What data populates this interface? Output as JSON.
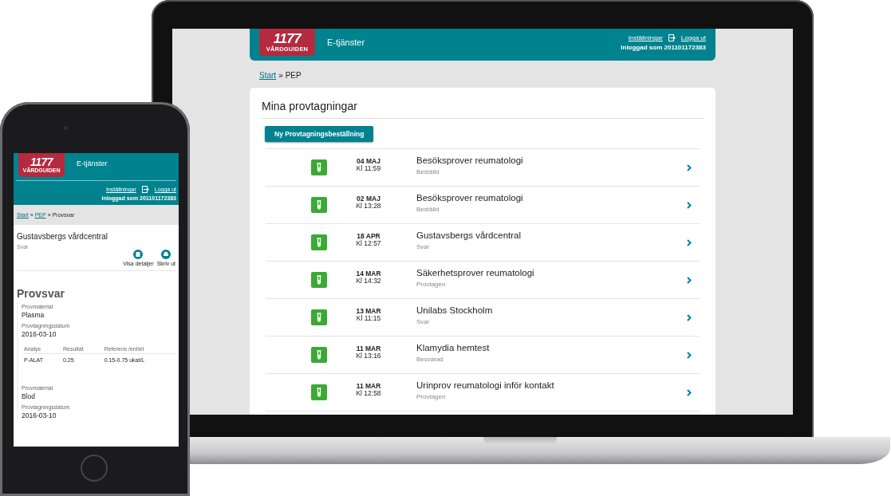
{
  "laptop": {
    "header": {
      "logo_number": "1177",
      "logo_name": "VÅRDGUIDEN",
      "service": "E-tjänster",
      "settings_link": "Inställningar",
      "logout_link": "Logga ut",
      "logged_in": "Inloggad som 201101172383"
    },
    "breadcrumb": [
      {
        "text": "Start",
        "link": true
      },
      {
        "text": "»",
        "link": false
      },
      {
        "text": "PEP",
        "link": false
      }
    ],
    "title": "Mina provtagningar",
    "new_button": "Ny Provtagningsbeställning",
    "orders": [
      {
        "date": "04 MAJ",
        "time": "Kl 11:59",
        "title": "Besöksprover reumatologi",
        "status": "Beställd"
      },
      {
        "date": "02 MAJ",
        "time": "Kl 13:28",
        "title": "Besöksprover reumatologi",
        "status": "Beställd"
      },
      {
        "date": "18 APR",
        "time": "Kl 12:57",
        "title": "Gustavsbergs vårdcentral",
        "status": "Svar"
      },
      {
        "date": "14 MAR",
        "time": "Kl 14:32",
        "title": "Säkerhetsprover reumatologi",
        "status": "Provtagen"
      },
      {
        "date": "13 MAR",
        "time": "Kl 11:15",
        "title": "Unilabs Stockholm",
        "status": "Svar"
      },
      {
        "date": "11 MAR",
        "time": "Kl 13:16",
        "title": "Klamydia hemtest",
        "status": "Besvarad"
      },
      {
        "date": "11 MAR",
        "time": "Kl 12:58",
        "title": "Urinprov reumatologi inför kontakt",
        "status": "Provtagen"
      }
    ]
  },
  "phone": {
    "header": {
      "logo_number": "1177",
      "logo_name": "VÅRDGUIDEN",
      "service": "E-tjänster",
      "settings_link": "Inställningar",
      "logout_link": "Logga ut",
      "logged_in": "Inloggad som 201101172383"
    },
    "breadcrumb": [
      {
        "text": "Start",
        "link": true
      },
      {
        "text": "»",
        "link": false
      },
      {
        "text": "PEP",
        "link": true
      },
      {
        "text": "»",
        "link": false
      },
      {
        "text": "Provsvar",
        "link": false
      }
    ],
    "place": "Gustavsbergs vårdcentral",
    "status": "Svar",
    "actions": [
      {
        "kind": "details",
        "label": "Visa detaljer"
      },
      {
        "kind": "print",
        "label": "Skriv ut"
      }
    ],
    "heading": "Provsvar",
    "samples": [
      {
        "material_label": "Provmaterial",
        "material": "Plasma",
        "date_label": "Provtagningsdatum",
        "date": "2016-03-10",
        "table": {
          "columns": [
            "Analys",
            "Resultat",
            "Referens /enhet"
          ],
          "rows": [
            [
              "P-ALAT",
              "0.25",
              "0.15-0.75  ukat/L"
            ]
          ]
        }
      },
      {
        "material_label": "Provmaterial",
        "material": "Blod",
        "date_label": "Provtagningsdatum",
        "date": "2016-03-10"
      }
    ]
  }
}
